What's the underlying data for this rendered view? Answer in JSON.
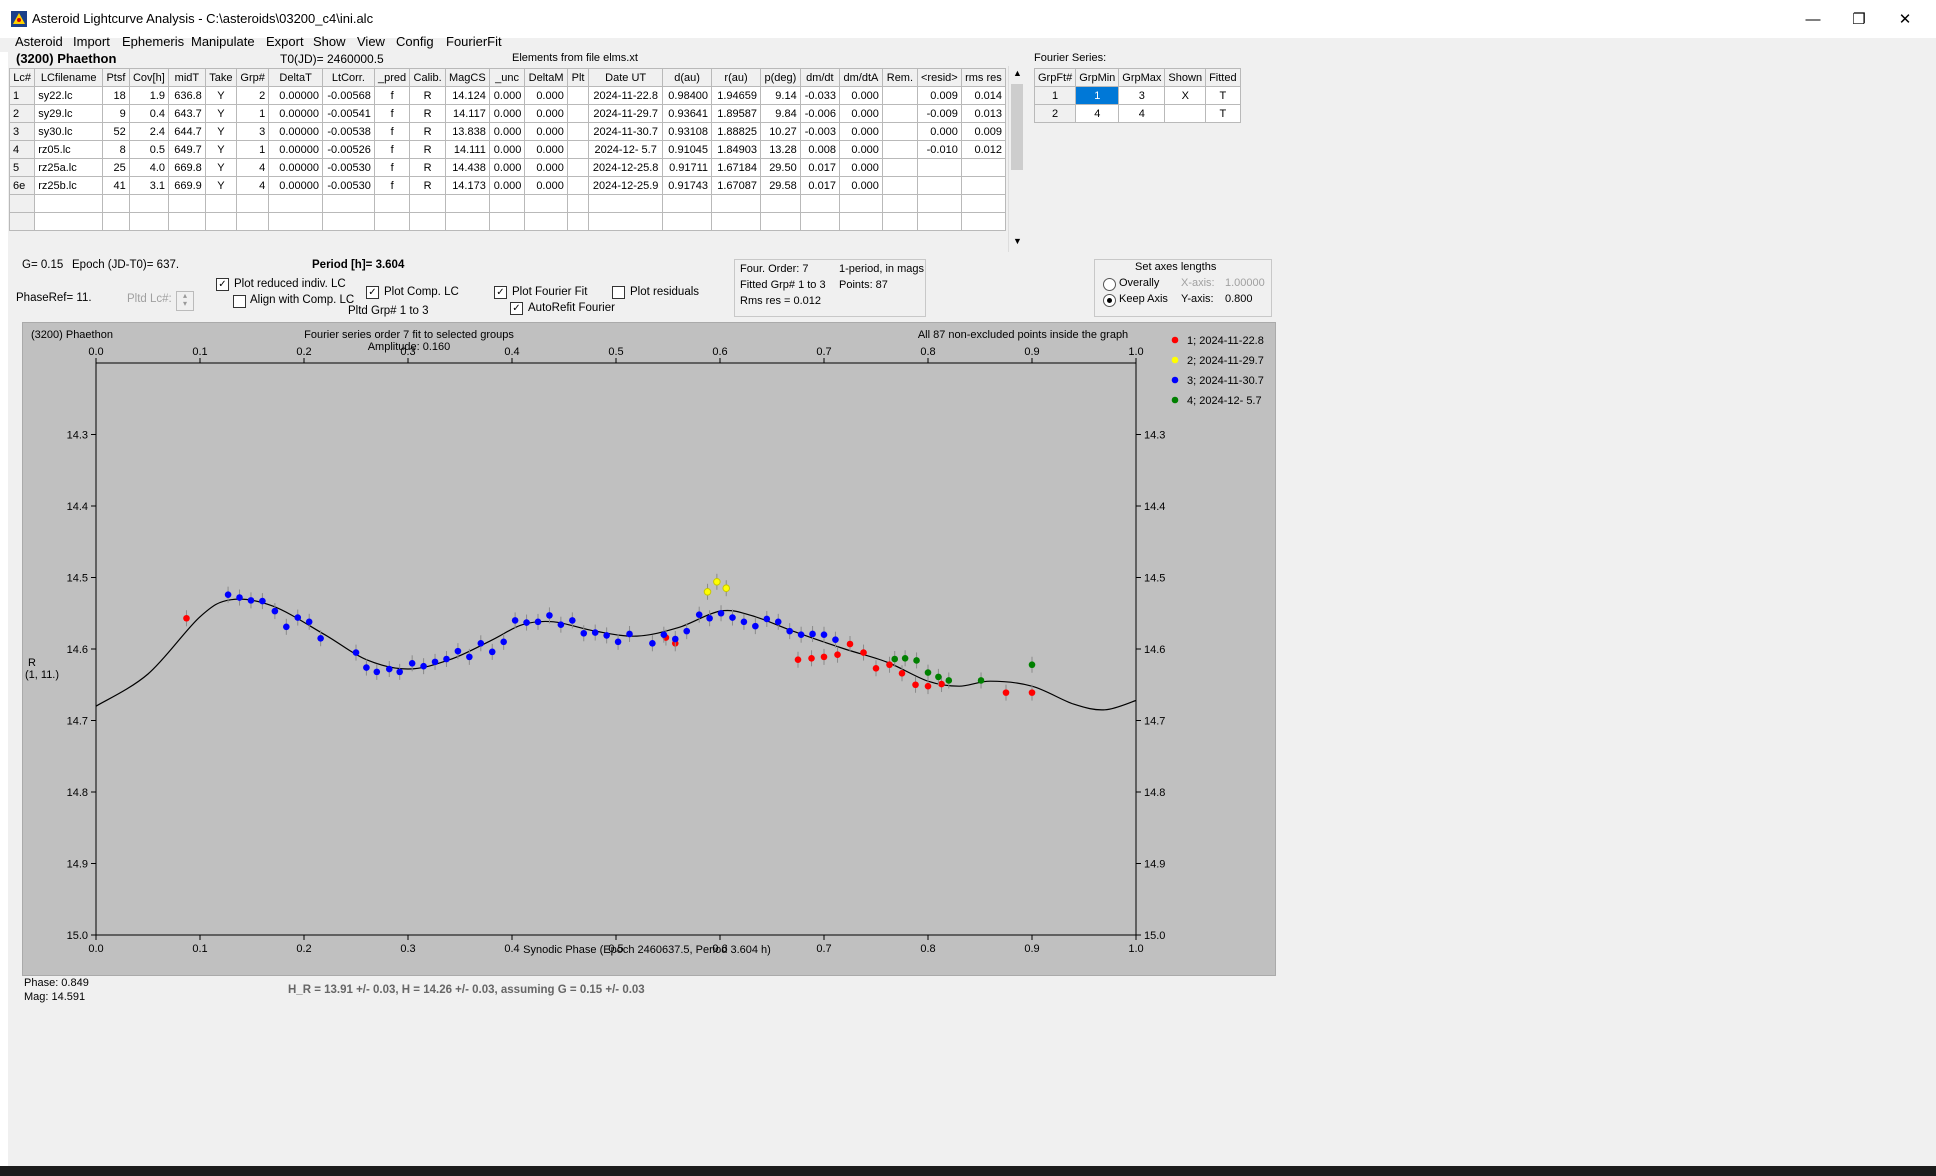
{
  "window": {
    "title": "Asteroid Lightcurve Analysis - C:\\asteroids\\03200_c4\\ini.alc",
    "minimize": "—",
    "restore": "❐",
    "close": "✕"
  },
  "menu": [
    "Asteroid",
    "Import",
    "Ephemeris",
    "Manipulate",
    "Export",
    "Show",
    "View",
    "Config",
    "FourierFit"
  ],
  "header": {
    "asteroid": "(3200) Phaethon",
    "t0": "T0(JD)= 2460000.5",
    "elements": "Elements from file elms.xt",
    "fourier_label": "Fourier Series:"
  },
  "lc_table": {
    "columns": [
      "Lc#",
      "LCfilename",
      "Ptsf",
      "Cov[h]",
      "midT",
      "Take",
      "Grp#",
      "DeltaT",
      "LtCorr.",
      "_pred",
      "Calib.",
      "MagCS",
      "_unc",
      "DeltaM",
      "Plt",
      "Date UT",
      "d(au)",
      "r(au)",
      "p(deg)",
      "dm/dt",
      "dm/dtA",
      "Rem.",
      "<resid>",
      "rms res"
    ],
    "rows": [
      [
        "1",
        "sy22.lc",
        "18",
        "1.9",
        "636.8",
        "Y",
        "2",
        "0.00000",
        "-0.00568",
        "f",
        "R",
        "14.124",
        "0.000",
        "0.000",
        "",
        "2024-11-22.8",
        "0.98400",
        "1.94659",
        "9.14",
        "-0.033",
        "0.000",
        "",
        "0.009",
        "0.014"
      ],
      [
        "2",
        "sy29.lc",
        "9",
        "0.4",
        "643.7",
        "Y",
        "1",
        "0.00000",
        "-0.00541",
        "f",
        "R",
        "14.117",
        "0.000",
        "0.000",
        "",
        "2024-11-29.7",
        "0.93641",
        "1.89587",
        "9.84",
        "-0.006",
        "0.000",
        "",
        "-0.009",
        "0.013"
      ],
      [
        "3",
        "sy30.lc",
        "52",
        "2.4",
        "644.7",
        "Y",
        "3",
        "0.00000",
        "-0.00538",
        "f",
        "R",
        "13.838",
        "0.000",
        "0.000",
        "",
        "2024-11-30.7",
        "0.93108",
        "1.88825",
        "10.27",
        "-0.003",
        "0.000",
        "",
        "0.000",
        "0.009"
      ],
      [
        "4",
        "rz05.lc",
        "8",
        "0.5",
        "649.7",
        "Y",
        "1",
        "0.00000",
        "-0.00526",
        "f",
        "R",
        "14.111",
        "0.000",
        "0.000",
        "",
        "2024-12- 5.7",
        "0.91045",
        "1.84903",
        "13.28",
        "0.008",
        "0.000",
        "",
        "-0.010",
        "0.012"
      ],
      [
        "5",
        "rz25a.lc",
        "25",
        "4.0",
        "669.8",
        "Y",
        "4",
        "0.00000",
        "-0.00530",
        "f",
        "R",
        "14.438",
        "0.000",
        "0.000",
        "",
        "2024-12-25.8",
        "0.91711",
        "1.67184",
        "29.50",
        "0.017",
        "0.000",
        "",
        "",
        ""
      ],
      [
        "6e",
        "rz25b.lc",
        "41",
        "3.1",
        "669.9",
        "Y",
        "4",
        "0.00000",
        "-0.00530",
        "f",
        "R",
        "14.173",
        "0.000",
        "0.000",
        "",
        "2024-12-25.9",
        "0.91743",
        "1.67087",
        "29.58",
        "0.017",
        "0.000",
        "",
        "",
        ""
      ]
    ]
  },
  "fourier_table": {
    "columns": [
      "GrpFt#",
      "GrpMin",
      "GrpMax",
      "Shown",
      "Fitted"
    ],
    "rows": [
      [
        "1",
        "1",
        "3",
        "X",
        "T"
      ],
      [
        "2",
        "4",
        "4",
        "",
        "T"
      ]
    ]
  },
  "controls": {
    "g": "G= 0.15",
    "epoch": "Epoch (JD-T0)= 637.",
    "period": "Period [h]= 3.604",
    "phaseref": "PhaseRef= 11.",
    "pltd_lc": "Pltd Lc#:",
    "plot_reduced": "Plot reduced indiv. LC",
    "align_comp": "Align with Comp. LC",
    "plot_comp": "Plot Comp. LC",
    "pltd_grp": "Pltd Grp#  1   to   3",
    "plot_fourier": "Plot Fourier Fit",
    "autorefit": "AutoRefit Fourier",
    "plot_residuals": "Plot residuals",
    "four_order": "Four. Order:  7",
    "one_period": "1-period, in mags",
    "fitted_grp": "Fitted Grp# 1 to 3",
    "points": "Points: 87",
    "rms": "Rms res      = 0.012",
    "axes_title": "Set axes lengths",
    "overally": "Overally",
    "keep_axis": "Keep Axis",
    "xaxis_label": "X-axis:",
    "xaxis_val": "1.00000",
    "yaxis_label": "Y-axis:",
    "yaxis_val": "0.800"
  },
  "plot": {
    "name": "(3200) Phaethon",
    "fourier_title": "Fourier series order 7 fit to selected groups",
    "amplitude": "Amplitude: 0.160",
    "points_note": "All 87 non-excluded points inside the graph",
    "ylabel": "R",
    "ylabel2": "(1, 11.)",
    "xlabel": "Synodic Phase (Epoch 2460637.5, Period 3.604 h)"
  },
  "chart_data": {
    "type": "scatter",
    "xlim": [
      0,
      1
    ],
    "ylim": [
      14.2,
      15.0
    ],
    "y_inverted": true,
    "xticks": [
      "0.0",
      "0.1",
      "0.2",
      "0.3",
      "0.4",
      "0.5",
      "0.6",
      "0.7",
      "0.8",
      "0.9",
      "1.0"
    ],
    "yticks": [
      "14.3",
      "14.4",
      "14.5",
      "14.6",
      "14.7",
      "14.8",
      "14.9",
      "15.0"
    ],
    "legend": [
      {
        "label": "1; 2024-11-22.8",
        "color": "#ff0000"
      },
      {
        "label": "2; 2024-11-29.7",
        "color": "#ffff00"
      },
      {
        "label": "3; 2024-11-30.7",
        "color": "#0000ff"
      },
      {
        "label": "4; 2024-12- 5.7",
        "color": "#008000"
      }
    ],
    "series": [
      {
        "color": "#ff0000",
        "points": [
          [
            0.087,
            14.557
          ],
          [
            0.548,
            14.584
          ],
          [
            0.557,
            14.592
          ],
          [
            0.675,
            14.615
          ],
          [
            0.688,
            14.613
          ],
          [
            0.7,
            14.611
          ],
          [
            0.713,
            14.608
          ],
          [
            0.725,
            14.593
          ],
          [
            0.738,
            14.605
          ],
          [
            0.75,
            14.627
          ],
          [
            0.763,
            14.622
          ],
          [
            0.775,
            14.634
          ],
          [
            0.788,
            14.65
          ],
          [
            0.8,
            14.652
          ],
          [
            0.813,
            14.649
          ],
          [
            0.875,
            14.661
          ],
          [
            0.9,
            14.661
          ]
        ]
      },
      {
        "color": "#ffff00",
        "points": [
          [
            0.588,
            14.52
          ],
          [
            0.597,
            14.506
          ],
          [
            0.606,
            14.515
          ]
        ]
      },
      {
        "color": "#0000ff",
        "points": [
          [
            0.127,
            14.524
          ],
          [
            0.138,
            14.528
          ],
          [
            0.149,
            14.532
          ],
          [
            0.16,
            14.533
          ],
          [
            0.172,
            14.547
          ],
          [
            0.183,
            14.569
          ],
          [
            0.194,
            14.556
          ],
          [
            0.205,
            14.562
          ],
          [
            0.216,
            14.585
          ],
          [
            0.25,
            14.605
          ],
          [
            0.26,
            14.626
          ],
          [
            0.27,
            14.632
          ],
          [
            0.282,
            14.628
          ],
          [
            0.292,
            14.632
          ],
          [
            0.304,
            14.62
          ],
          [
            0.315,
            14.624
          ],
          [
            0.326,
            14.618
          ],
          [
            0.337,
            14.614
          ],
          [
            0.348,
            14.603
          ],
          [
            0.359,
            14.611
          ],
          [
            0.37,
            14.592
          ],
          [
            0.381,
            14.604
          ],
          [
            0.392,
            14.59
          ],
          [
            0.403,
            14.56
          ],
          [
            0.414,
            14.563
          ],
          [
            0.425,
            14.562
          ],
          [
            0.436,
            14.553
          ],
          [
            0.447,
            14.566
          ],
          [
            0.458,
            14.56
          ],
          [
            0.469,
            14.578
          ],
          [
            0.48,
            14.577
          ],
          [
            0.491,
            14.581
          ],
          [
            0.502,
            14.59
          ],
          [
            0.513,
            14.579
          ],
          [
            0.535,
            14.592
          ],
          [
            0.546,
            14.58
          ],
          [
            0.557,
            14.586
          ],
          [
            0.568,
            14.575
          ],
          [
            0.58,
            14.552
          ],
          [
            0.59,
            14.557
          ],
          [
            0.601,
            14.55
          ],
          [
            0.612,
            14.556
          ],
          [
            0.623,
            14.562
          ],
          [
            0.634,
            14.568
          ],
          [
            0.645,
            14.558
          ],
          [
            0.656,
            14.562
          ],
          [
            0.667,
            14.575
          ],
          [
            0.678,
            14.58
          ],
          [
            0.689,
            14.579
          ],
          [
            0.7,
            14.58
          ],
          [
            0.711,
            14.587
          ]
        ]
      },
      {
        "color": "#008000",
        "points": [
          [
            0.768,
            14.614
          ],
          [
            0.778,
            14.613
          ],
          [
            0.789,
            14.616
          ],
          [
            0.8,
            14.633
          ],
          [
            0.81,
            14.639
          ],
          [
            0.82,
            14.644
          ],
          [
            0.851,
            14.644
          ],
          [
            0.9,
            14.622
          ]
        ]
      }
    ]
  },
  "footer": {
    "phase": "Phase:  0.849",
    "mag": "Mag:    14.591",
    "hr": "H_R = 13.91 +/- 0.03, H = 14.26 +/- 0.03, assuming G = 0.15 +/- 0.03"
  }
}
